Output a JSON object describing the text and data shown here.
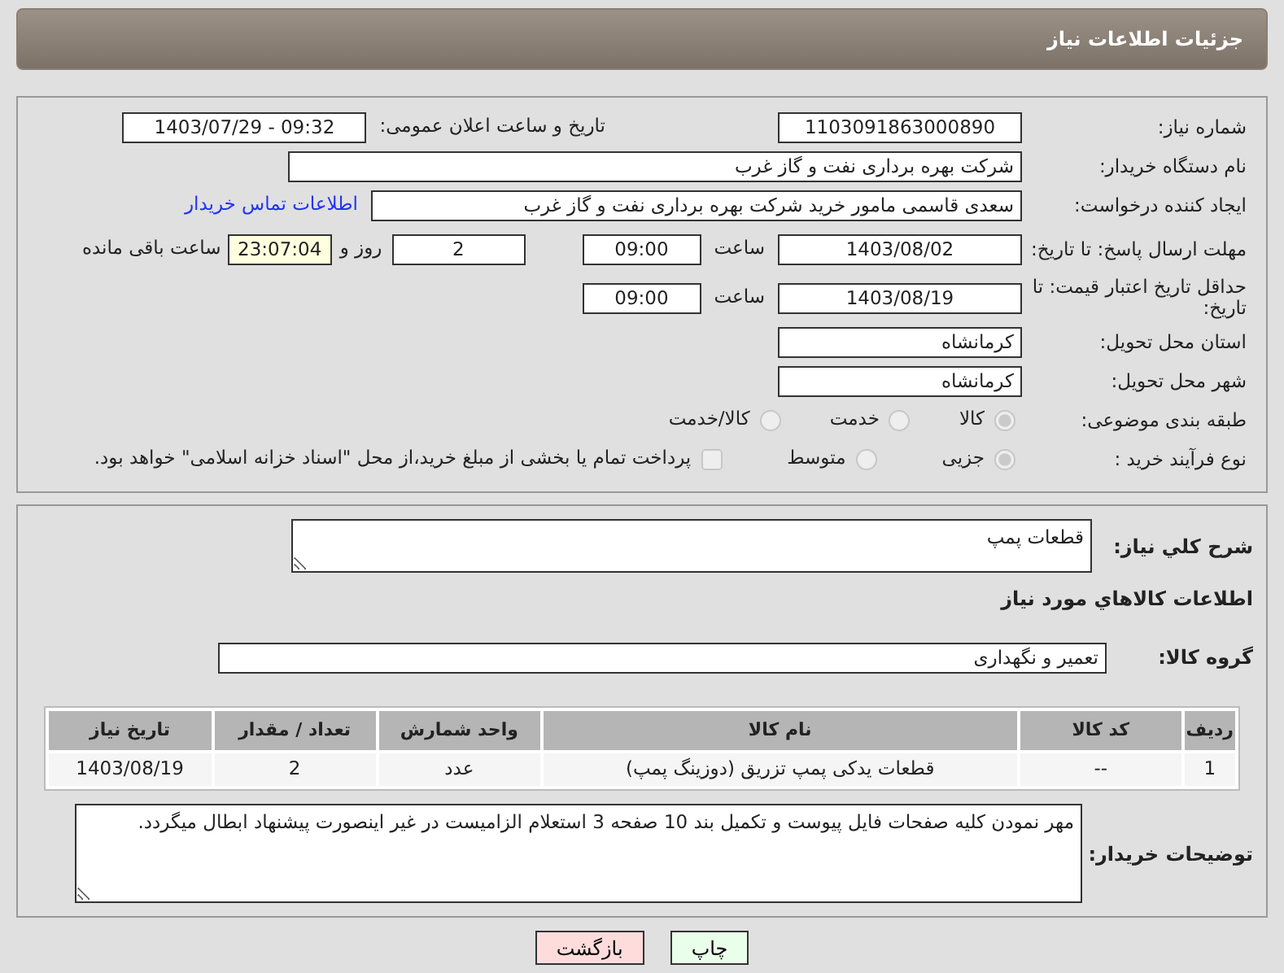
{
  "header": {
    "title": "جزئیات اطلاعات نیاز"
  },
  "details": {
    "need_number": {
      "label": "شماره نیاز:",
      "value": "1103091863000890"
    },
    "announce": {
      "label": "تاریخ و ساعت اعلان عمومی:",
      "value": "1403/07/29 - 09:32"
    },
    "buyer_org": {
      "label": "نام دستگاه خریدار:",
      "value": "شرکت بهره برداری نفت و گاز غرب"
    },
    "requester": {
      "label": "ایجاد کننده درخواست:",
      "value": "سعدی قاسمی مامور خرید شرکت بهره برداری نفت و گاز غرب",
      "link": "اطلاعات تماس خریدار"
    },
    "reply_deadline": {
      "label": "مهلت ارسال پاسخ: تا تاریخ:",
      "date": "1403/08/02",
      "time_label": "ساعت",
      "time": "09:00",
      "days": "2",
      "days_label": "روز و",
      "remaining": "23:07:04",
      "remaining_label": "ساعت باقی مانده"
    },
    "price_validity": {
      "label": "حداقل تاریخ اعتبار قیمت: تا تاریخ:",
      "date": "1403/08/19",
      "time_label": "ساعت",
      "time": "09:00"
    },
    "province": {
      "label": "استان محل تحویل:",
      "value": "کرمانشاه"
    },
    "city": {
      "label": "شهر محل تحویل:",
      "value": "کرمانشاه"
    },
    "category": {
      "label": "طبقه بندی موضوعی:",
      "options": [
        {
          "label": "کالا",
          "selected": true
        },
        {
          "label": "خدمت",
          "selected": false
        },
        {
          "label": "کالا/خدمت",
          "selected": false
        }
      ]
    },
    "process": {
      "label": "نوع فرآیند خرید :",
      "options": [
        {
          "label": "جزیی",
          "selected": true
        },
        {
          "label": "متوسط",
          "selected": false
        }
      ],
      "treasury": {
        "label": "پرداخت تمام یا بخشی از مبلغ خرید،از محل \"اسناد خزانه اسلامی\" خواهد بود.",
        "checked": false
      }
    }
  },
  "goods": {
    "description": {
      "label": "شرح کلي نياز:",
      "value": "قطعات پمپ"
    },
    "heading": "اطلاعات کالاهاي مورد نياز",
    "group": {
      "label": "گروه کالا:",
      "value": "تعمیر و نگهداری"
    },
    "table": {
      "columns": [
        "ردیف",
        "کد کالا",
        "نام کالا",
        "واحد شمارش",
        "تعداد / مقدار",
        "تاریخ نیاز"
      ],
      "rows": [
        [
          "1",
          "--",
          "قطعات یدکی پمپ تزریق (دوزینگ پمپ)",
          "عدد",
          "2",
          "1403/08/19"
        ]
      ]
    },
    "buyer_notes": {
      "label": "توضیحات خریدار:",
      "value": "مهر نمودن کلیه صفحات فایل پیوست و تکمیل بند 10 صفحه 3 استعلام الزامیست در غیر اینصورت پیشنهاد ابطال میگردد."
    }
  },
  "buttons": [
    {
      "label": "چاپ",
      "kind": "print"
    },
    {
      "label": "بازگشت",
      "kind": "back"
    }
  ]
}
